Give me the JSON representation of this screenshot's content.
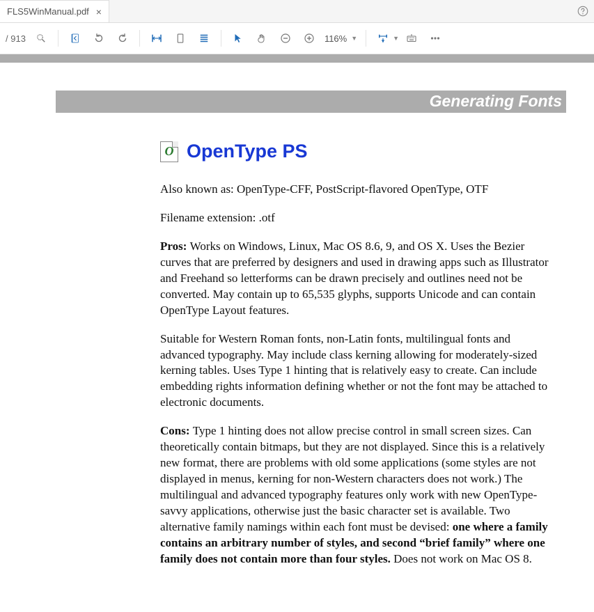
{
  "tab": {
    "title": "FLS5WinManual.pdf"
  },
  "toolbar": {
    "page_total_prefix": "/ ",
    "page_total": "913",
    "zoom": "116%"
  },
  "document": {
    "banner": "Generating Fonts",
    "heading_icon_letter": "O",
    "heading": "OpenType PS",
    "aka_label": "Also known as: ",
    "aka_value": "OpenType-CFF, PostScript-flavored OpenType, OTF",
    "ext_label": "Filename extension: ",
    "ext_value": ".otf",
    "pros_label": "Pros: ",
    "pros_text": "Works on Windows, Linux, Mac OS 8.6, 9, and OS X. Uses the Bezier curves that are preferred by designers and used in drawing apps such as Illustrator and Freehand so letterforms can be drawn precisely and outlines need not be converted. May contain up to 65,535 glyphs, supports Unicode and can contain OpenType Layout features.",
    "suitable_text": "Suitable for Western Roman fonts, non-Latin fonts, multilingual fonts and advanced typography. May include class kerning allowing for moderately-sized kerning tables. Uses Type 1 hinting that is relatively easy to create. Can include embedding rights information defining whether or not the font may be attached to electronic documents.",
    "cons_label": "Cons: ",
    "cons_text_a": "Type 1 hinting does not allow precise control in small screen sizes. Can theoretically contain bitmaps, but they are not displayed. Since this is a relatively new format, there are problems with old some applications (some styles are not displayed in menus, kerning for non-Western characters does not work.) The multilingual and advanced typography features only work with new OpenType-savvy applications, otherwise just the basic character set is available. Two alternative family namings within each font must be devised: ",
    "cons_text_b": "one where a family contains an arbitrary number of styles, and second “brief family” where one family does not contain more than four styles.",
    "cons_text_c": " Does not work on Mac OS 8."
  }
}
